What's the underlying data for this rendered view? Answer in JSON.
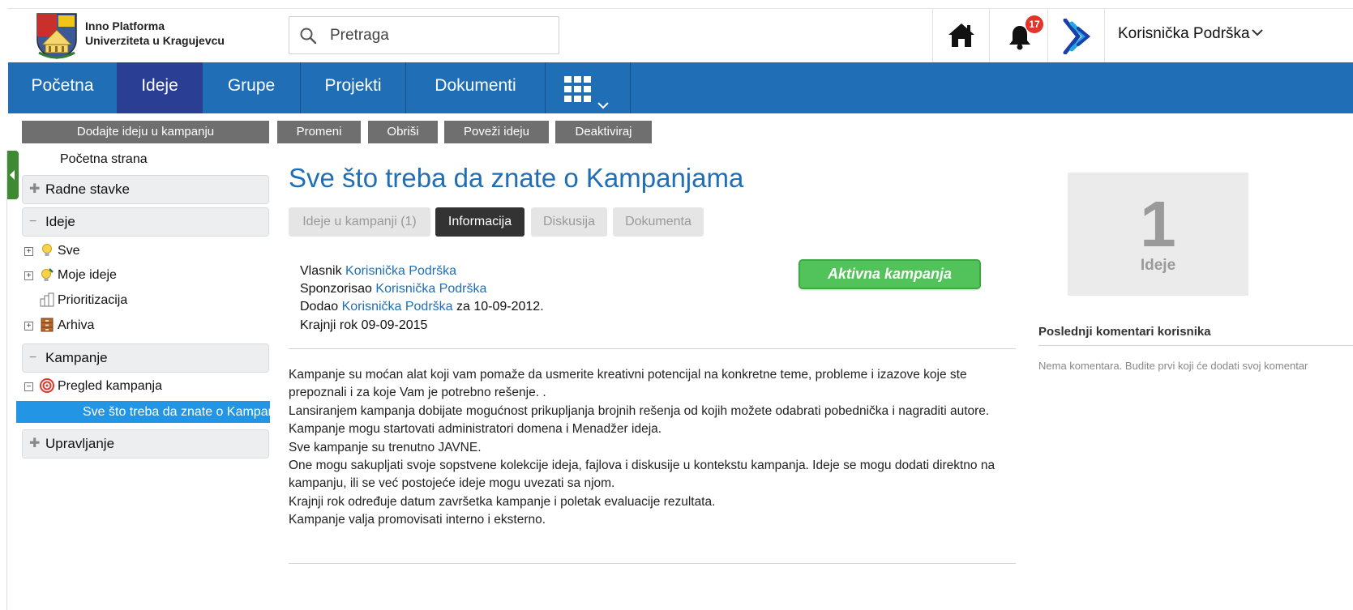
{
  "header": {
    "logo_line1": "Inno Platforma",
    "logo_line2": "Univerziteta u Kragujevcu",
    "search_placeholder": "Pretraga",
    "notification_count": "17",
    "user_name": "Korisnička Podrška",
    "icons": [
      "home-icon",
      "bell-icon",
      "brand-logo-icon",
      "chevron-down-icon",
      "search-icon"
    ]
  },
  "nav": {
    "items": [
      "Početna",
      "Ideje",
      "Grupe",
      "Projekti",
      "Dokumenti"
    ],
    "active": "Ideje",
    "apps_icon": "grid-icon"
  },
  "actions": [
    "Dodajte ideju u kampanju",
    "Promeni",
    "Obriši",
    "Poveži ideju",
    "Deaktiviraj"
  ],
  "sidebar": {
    "home_link": "Početna strana",
    "sections": {
      "work_items": "Radne stavke",
      "ideas": "Ideje",
      "campaigns": "Kampanje",
      "management": "Upravljanje"
    },
    "idea_items": [
      "Sve",
      "Moje ideje",
      "Prioritizacija",
      "Arhiva"
    ],
    "campaign_items": [
      "Pregled kampanja"
    ],
    "selected_item": "Sve što treba da znate o Kampanjama"
  },
  "main": {
    "title": "Sve što treba da znate o Kampanjama",
    "tabs": [
      "Ideje u kampanji (1)",
      "Informacija",
      "Diskusija",
      "Dokumenta"
    ],
    "active_tab": "Informacija",
    "owner_label": "Vlasnik",
    "owner": "Korisnička Podrška",
    "sponsor_label": "Sponzorisao",
    "sponsor": "Korisnička Podrška",
    "added_label": "Dodao",
    "added_by": "Korisnička Podrška",
    "added_date": "za 10-09-2012.",
    "deadline": "Krajnji rok 09-09-2015",
    "status_badge": "Aktivna kampanja",
    "description": [
      "Kampanje su moćan alat koji vam pomaže da usmerite kreativni potencijal na konkretne teme, probleme i izazove koje ste prepoznali i za koje Vam je potrebno rešenje. .",
      "Lansiranjem kampanja dobijate mogućnost prikupljanja brojnih rešenja od kojih možete odabrati pobednička i nagraditi autore.",
      "Kampanje mogu startovati administratori domena i Menadžer ideja.",
      "Sve kampanje su trenutno JAVNE.",
      "One mogu sakupljati svoje sopstvene kolekcije ideja, fajlova i diskusije u kontekstu kampanja. Ideje se mogu dodati direktno na kampanju, ili se već postojeće ideje mogu uvezati sa njom.",
      "Krajnji rok određuje datum završetka kampanje i poletak evaluacije rezultata.",
      "Kampanje valja promovisati interno i eksterno."
    ]
  },
  "right": {
    "stat_value": "1",
    "stat_label": "Ideje",
    "comments_title": "Poslednji komentari korisnika",
    "comments_empty": "Nema komentara. Budite prvi koji će dodati svoj komentar"
  },
  "colors": {
    "nav_bg": "#1f6eb6",
    "nav_active": "#2a3e94",
    "action_btn": "#6f6f6f",
    "selected": "#2295e5",
    "active_badge": "#52c35a",
    "link": "#1f6eb6"
  }
}
